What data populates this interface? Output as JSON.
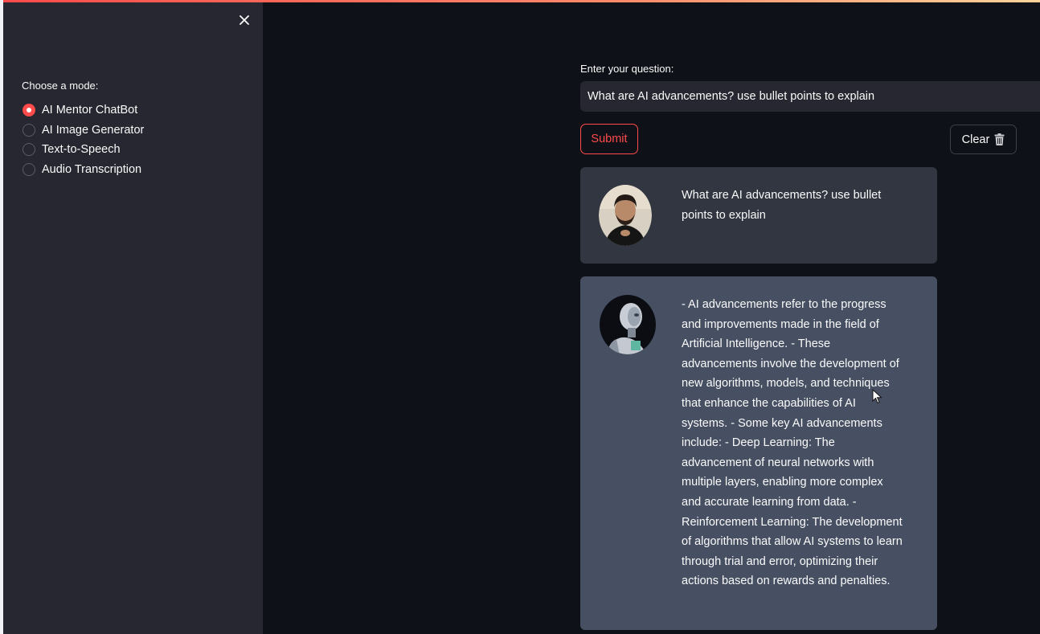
{
  "sidebar": {
    "close_icon": "close-icon",
    "mode_label": "Choose a mode:",
    "modes": [
      {
        "label": "AI Mentor ChatBot",
        "selected": true
      },
      {
        "label": "AI Image Generator",
        "selected": false
      },
      {
        "label": "Text-to-Speech",
        "selected": false
      },
      {
        "label": "Audio Transcription",
        "selected": false
      }
    ]
  },
  "main": {
    "question_label": "Enter your question:",
    "question_value": "What are AI advancements? use bullet points to explain",
    "submit_label": "Submit",
    "clear_label": "Clear",
    "clear_icon": "trash-icon",
    "messages": [
      {
        "role": "user",
        "avatar": "user-avatar",
        "text": "What are AI advancements? use bullet points to explain"
      },
      {
        "role": "bot",
        "avatar": "robot-avatar",
        "text": "- AI advancements refer to the progress and improvements made in the field of Artificial Intelligence. - These advancements involve the development of new algorithms, models, and techniques that enhance the capabilities of AI systems. - Some key AI advancements include: - Deep Learning: The advancement of neural networks with multiple layers, enabling more complex and accurate learning from data. - Reinforcement Learning: The development of algorithms that allow AI systems to learn through trial and error, optimizing their actions based on rewards and penalties."
      }
    ]
  },
  "colors": {
    "accent": "#ff4b4b",
    "background": "#0e1117",
    "sidebar": "#262730",
    "user_bubble": "#323641",
    "bot_bubble": "#475063"
  }
}
